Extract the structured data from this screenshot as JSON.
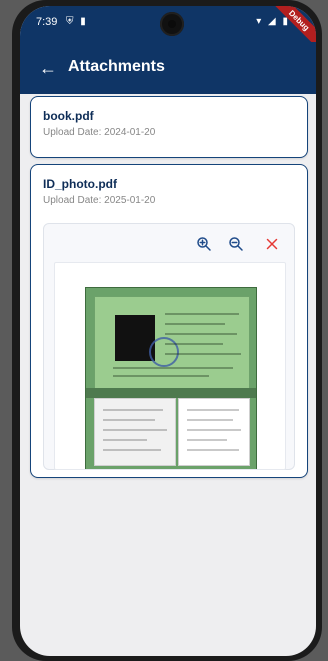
{
  "status_bar": {
    "time": "7:39",
    "left_icons": [
      "shield-icon",
      "sim-icon"
    ],
    "right_icons": [
      "wifi-icon",
      "signal-icon",
      "battery-icon"
    ],
    "debug_label": "Debug"
  },
  "app_bar": {
    "title": "Attachments",
    "back_icon": "arrow-left-icon"
  },
  "attachments": [
    {
      "name": "book.pdf",
      "upload_date_label": "Upload Date: 2024-01-20"
    },
    {
      "name": "ID_photo.pdf",
      "upload_date_label": "Upload Date: 2025-01-20"
    }
  ],
  "viewer": {
    "tools": [
      {
        "icon": "zoom-in-icon"
      },
      {
        "icon": "zoom-out-icon"
      },
      {
        "icon": "close-icon"
      }
    ],
    "preview_image": "id-card-photo"
  },
  "colors": {
    "appbar": "#0f3566",
    "card_border": "#15447a",
    "accent_blue": "#1f4b8a",
    "close_red": "#e53935"
  }
}
